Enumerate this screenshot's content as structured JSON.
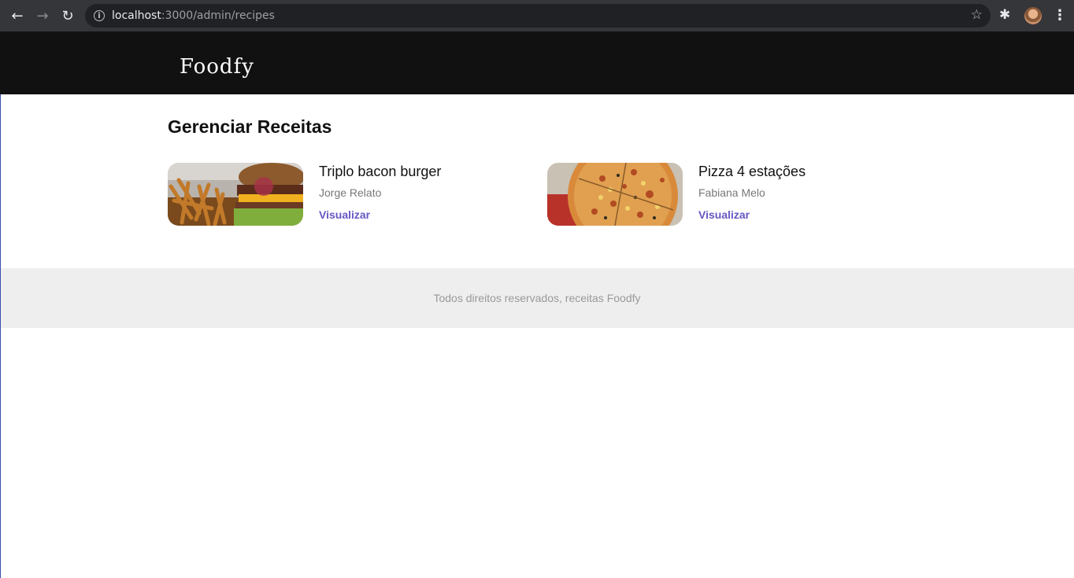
{
  "browser": {
    "url_host": "localhost",
    "url_rest": ":3000/admin/recipes"
  },
  "header": {
    "logo": "Foodfy"
  },
  "main": {
    "title": "Gerenciar Receitas",
    "recipes": [
      {
        "title": "Triplo bacon burger",
        "author": "Jorge Relato",
        "link": "Visualizar",
        "image": "burger-and-fries"
      },
      {
        "title": "Pizza 4 estações",
        "author": "Fabiana Melo",
        "link": "Visualizar",
        "image": "pizza"
      }
    ]
  },
  "footer": {
    "text": "Todos direitos reservados, receitas Foodfy"
  },
  "colors": {
    "accent": "#6558c3",
    "header_bg": "#111111",
    "footer_bg": "#eeeeee"
  }
}
